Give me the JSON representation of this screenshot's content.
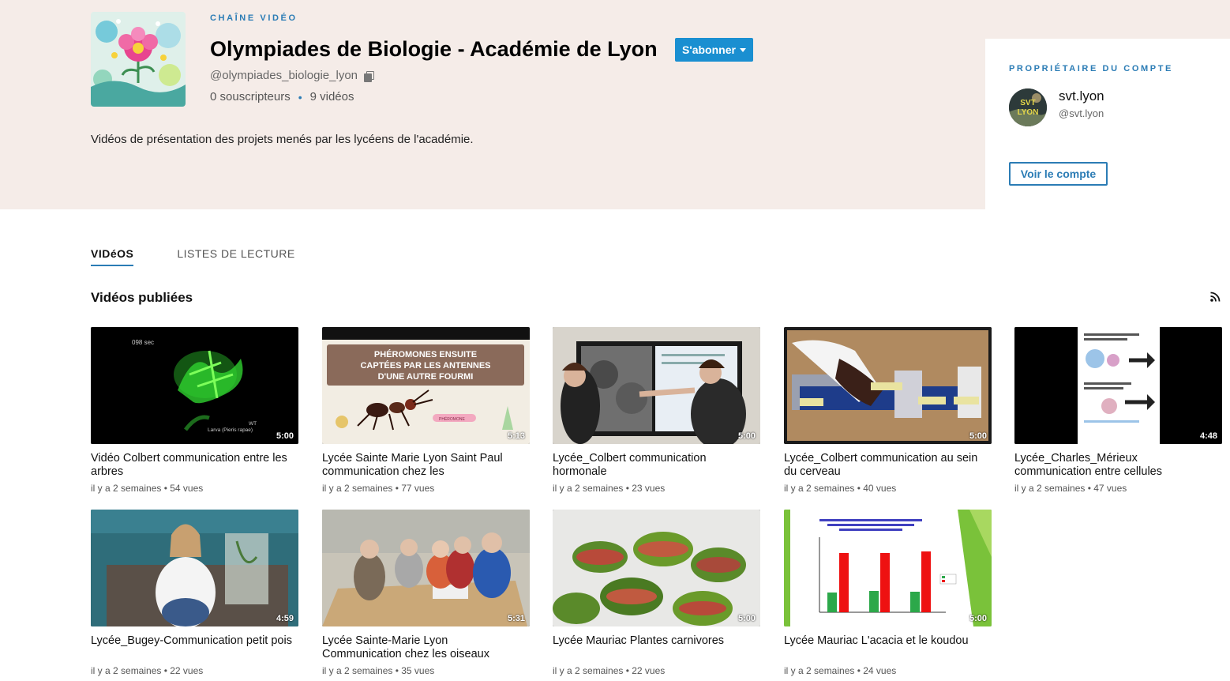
{
  "header": {
    "kicker": "CHAÎNE VIDÉO",
    "title": "Olympiades de Biologie - Académie de Lyon",
    "handle": "@olympiades_biologie_lyon",
    "subscribers": "0 souscripteurs",
    "videos_count": "9 vidéos",
    "subscribe_label": "S'abonner",
    "description": "Vidéos de présentation des projets menés par les lycéens de l'académie."
  },
  "owner": {
    "kicker": "PROPRIÉTAIRE DU COMPTE",
    "avatar_text_top": "SVT",
    "avatar_text_bottom": "LYON",
    "name": "svt.lyon",
    "handle": "@svt.lyon",
    "button_label": "Voir le compte"
  },
  "tabs": [
    {
      "label": "VIDéOS",
      "active": true
    },
    {
      "label": "LISTES DE LECTURE",
      "active": false
    }
  ],
  "section": {
    "title": "Vidéos publiées",
    "rss_icon": "rss-icon"
  },
  "thumb_text": {
    "v0_caption": "098 sec",
    "v0_wt": "WT",
    "v0_larva": "Larva (Pieris rapae)",
    "v1_banner_line1": "PHÉROMONES ENSUITE",
    "v1_banner_line2": "CAPTÉES PAR LES ANTENNES",
    "v1_banner_line3": "D'UNE AUTRE FOURMI",
    "v1_label": "PHÉROMONE"
  },
  "videos": [
    {
      "title": "Vidéo Colbert communication entre les arbres",
      "meta": "il y a 2 semaines • 54 vues",
      "duration": "5:00"
    },
    {
      "title": "Lycée Sainte Marie Lyon Saint Paul communication chez les",
      "meta": "il y a 2 semaines • 77 vues",
      "duration": "5:13"
    },
    {
      "title": "Lycée_Colbert communication hormonale",
      "meta": "il y a 2 semaines • 23 vues",
      "duration": "5:00"
    },
    {
      "title": "Lycée_Colbert communication au sein du cerveau",
      "meta": "il y a 2 semaines • 40 vues",
      "duration": "5:00"
    },
    {
      "title": "Lycée_Charles_Mérieux communication entre cellules",
      "meta": "il y a 2 semaines • 47 vues",
      "duration": "4:48"
    },
    {
      "title": "Lycée_Bugey-Communication petit pois",
      "meta": "il y a 2 semaines • 22 vues",
      "duration": "4:59"
    },
    {
      "title": "Lycée Sainte-Marie Lyon Communication chez les oiseaux",
      "meta": "il y a 2 semaines • 35 vues",
      "duration": "5:31"
    },
    {
      "title": "Lycée Mauriac Plantes carnivores",
      "meta": "il y a 2 semaines • 22 vues",
      "duration": "5:00"
    },
    {
      "title": "Lycée Mauriac L'acacia et le koudou",
      "meta": "il y a 2 semaines • 24 vues",
      "duration": "5:00"
    }
  ],
  "colors": {
    "accent": "#2b7cb5",
    "subscribe": "#1a8fd1",
    "header_bg": "#f5ece8"
  }
}
